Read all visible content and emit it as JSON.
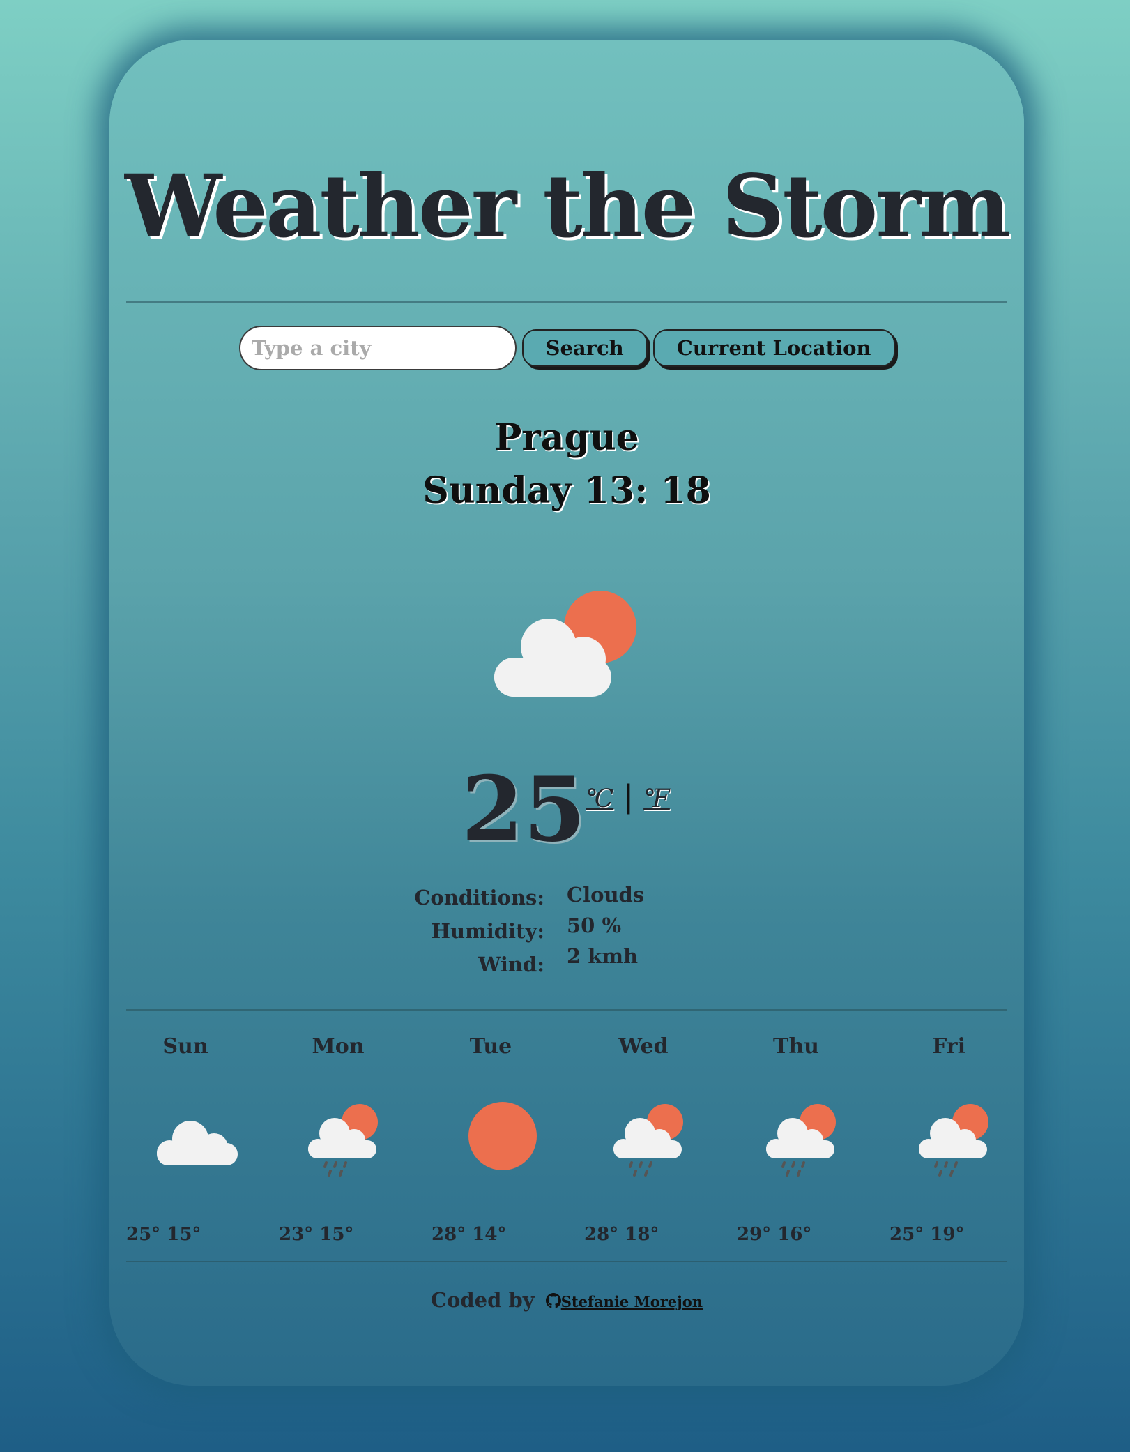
{
  "app": {
    "title": "Weather the Storm"
  },
  "search": {
    "placeholder": "Type a city",
    "value": "",
    "search_label": "Search",
    "location_label": "Current Location"
  },
  "current": {
    "city": "Prague",
    "datetime": "Sunday 13: 18",
    "icon": "cloud-sun-icon",
    "temperature": "25",
    "unit_celsius": "℃",
    "unit_separator": "|",
    "unit_fahrenheit": "℉",
    "details": [
      {
        "label": "Conditions:",
        "value": "Clouds"
      },
      {
        "label": "Humidity:",
        "value": "50 %"
      },
      {
        "label": "Wind:",
        "value": "2 kmh"
      }
    ]
  },
  "forecast": [
    {
      "day": "Sun",
      "icon": "cloud-icon",
      "temps": "25° 15°"
    },
    {
      "day": "Mon",
      "icon": "cloud-sun-rain-icon",
      "temps": "23° 15°"
    },
    {
      "day": "Tue",
      "icon": "sun-icon",
      "temps": "28° 14°"
    },
    {
      "day": "Wed",
      "icon": "cloud-sun-rain-icon",
      "temps": "28° 18°"
    },
    {
      "day": "Thu",
      "icon": "cloud-sun-rain-icon",
      "temps": "29° 16°"
    },
    {
      "day": "Fri",
      "icon": "cloud-sun-rain-icon",
      "temps": "25° 19°"
    }
  ],
  "footer": {
    "prefix": "Coded by",
    "author": "Stefanie Morejon",
    "icon": "github-icon"
  },
  "colors": {
    "sun": "#ec6f4e",
    "cloud": "#f2f2f2",
    "rain": "#555555",
    "text": "#23272e"
  }
}
